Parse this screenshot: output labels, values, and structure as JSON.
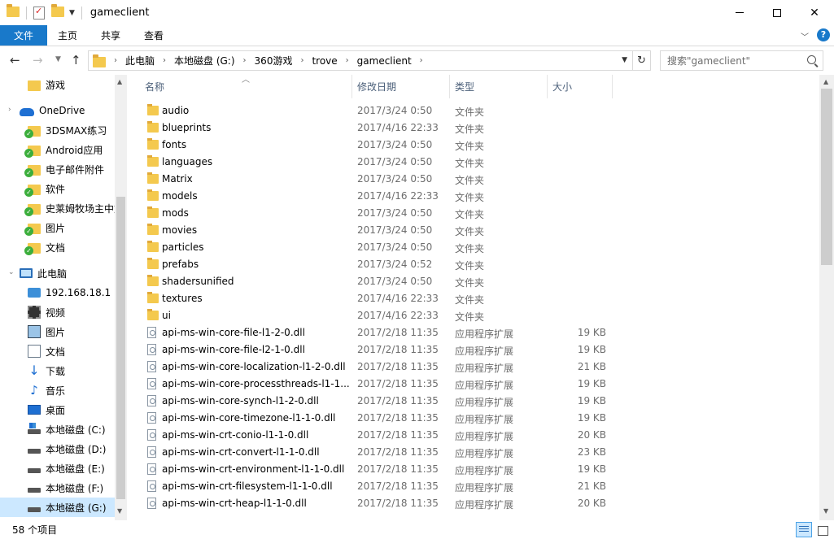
{
  "window": {
    "title": "gameclient"
  },
  "ribbon": {
    "tabs": [
      "文件",
      "主页",
      "共享",
      "查看"
    ]
  },
  "address": {
    "crumbs": [
      "此电脑",
      "本地磁盘 (G:)",
      "360游戏",
      "trove",
      "gameclient"
    ]
  },
  "search": {
    "placeholder": "搜索\"gameclient\""
  },
  "nav": {
    "items": [
      {
        "label": "游戏",
        "icon": "folder-icon"
      },
      {
        "label": "OneDrive",
        "icon": "cloud-icon"
      },
      {
        "label": "3DSMAX练习",
        "icon": "folder-synced-icon"
      },
      {
        "label": "Android应用",
        "icon": "folder-synced-icon"
      },
      {
        "label": "电子邮件附件",
        "icon": "folder-synced-icon"
      },
      {
        "label": "软件",
        "icon": "folder-synced-icon"
      },
      {
        "label": "史莱姆牧场主中文",
        "icon": "folder-synced-icon"
      },
      {
        "label": "图片",
        "icon": "folder-synced-icon"
      },
      {
        "label": "文档",
        "icon": "folder-synced-icon"
      },
      {
        "label": "此电脑",
        "icon": "pc-icon"
      },
      {
        "label": "192.168.18.1",
        "icon": "network-drive-icon"
      },
      {
        "label": "视频",
        "icon": "video-icon"
      },
      {
        "label": "图片",
        "icon": "pictures-icon"
      },
      {
        "label": "文档",
        "icon": "documents-icon"
      },
      {
        "label": "下载",
        "icon": "download-icon"
      },
      {
        "label": "音乐",
        "icon": "music-icon"
      },
      {
        "label": "桌面",
        "icon": "desktop-icon"
      },
      {
        "label": "本地磁盘 (C:)",
        "icon": "system-drive-icon"
      },
      {
        "label": "本地磁盘 (D:)",
        "icon": "drive-icon"
      },
      {
        "label": "本地磁盘 (E:)",
        "icon": "drive-icon"
      },
      {
        "label": "本地磁盘 (F:)",
        "icon": "drive-icon"
      },
      {
        "label": "本地磁盘 (G:)",
        "icon": "drive-icon",
        "selected": true
      }
    ]
  },
  "columns": {
    "name": "名称",
    "date": "修改日期",
    "type": "类型",
    "size": "大小"
  },
  "files": [
    {
      "name": "audio",
      "date": "2017/3/24 0:50",
      "type": "文件夹",
      "size": "",
      "kind": "folder"
    },
    {
      "name": "blueprints",
      "date": "2017/4/16 22:33",
      "type": "文件夹",
      "size": "",
      "kind": "folder"
    },
    {
      "name": "fonts",
      "date": "2017/3/24 0:50",
      "type": "文件夹",
      "size": "",
      "kind": "folder"
    },
    {
      "name": "languages",
      "date": "2017/3/24 0:50",
      "type": "文件夹",
      "size": "",
      "kind": "folder"
    },
    {
      "name": "Matrix",
      "date": "2017/3/24 0:50",
      "type": "文件夹",
      "size": "",
      "kind": "folder"
    },
    {
      "name": "models",
      "date": "2017/4/16 22:33",
      "type": "文件夹",
      "size": "",
      "kind": "folder"
    },
    {
      "name": "mods",
      "date": "2017/3/24 0:50",
      "type": "文件夹",
      "size": "",
      "kind": "folder"
    },
    {
      "name": "movies",
      "date": "2017/3/24 0:50",
      "type": "文件夹",
      "size": "",
      "kind": "folder"
    },
    {
      "name": "particles",
      "date": "2017/3/24 0:50",
      "type": "文件夹",
      "size": "",
      "kind": "folder"
    },
    {
      "name": "prefabs",
      "date": "2017/3/24 0:52",
      "type": "文件夹",
      "size": "",
      "kind": "folder"
    },
    {
      "name": "shadersunified",
      "date": "2017/3/24 0:50",
      "type": "文件夹",
      "size": "",
      "kind": "folder"
    },
    {
      "name": "textures",
      "date": "2017/4/16 22:33",
      "type": "文件夹",
      "size": "",
      "kind": "folder"
    },
    {
      "name": "ui",
      "date": "2017/4/16 22:33",
      "type": "文件夹",
      "size": "",
      "kind": "folder"
    },
    {
      "name": "api-ms-win-core-file-l1-2-0.dll",
      "date": "2017/2/18 11:35",
      "type": "应用程序扩展",
      "size": "19 KB",
      "kind": "dll"
    },
    {
      "name": "api-ms-win-core-file-l2-1-0.dll",
      "date": "2017/2/18 11:35",
      "type": "应用程序扩展",
      "size": "19 KB",
      "kind": "dll"
    },
    {
      "name": "api-ms-win-core-localization-l1-2-0.dll",
      "date": "2017/2/18 11:35",
      "type": "应用程序扩展",
      "size": "21 KB",
      "kind": "dll"
    },
    {
      "name": "api-ms-win-core-processthreads-l1-1...",
      "date": "2017/2/18 11:35",
      "type": "应用程序扩展",
      "size": "19 KB",
      "kind": "dll"
    },
    {
      "name": "api-ms-win-core-synch-l1-2-0.dll",
      "date": "2017/2/18 11:35",
      "type": "应用程序扩展",
      "size": "19 KB",
      "kind": "dll"
    },
    {
      "name": "api-ms-win-core-timezone-l1-1-0.dll",
      "date": "2017/2/18 11:35",
      "type": "应用程序扩展",
      "size": "19 KB",
      "kind": "dll"
    },
    {
      "name": "api-ms-win-crt-conio-l1-1-0.dll",
      "date": "2017/2/18 11:35",
      "type": "应用程序扩展",
      "size": "20 KB",
      "kind": "dll"
    },
    {
      "name": "api-ms-win-crt-convert-l1-1-0.dll",
      "date": "2017/2/18 11:35",
      "type": "应用程序扩展",
      "size": "23 KB",
      "kind": "dll"
    },
    {
      "name": "api-ms-win-crt-environment-l1-1-0.dll",
      "date": "2017/2/18 11:35",
      "type": "应用程序扩展",
      "size": "19 KB",
      "kind": "dll"
    },
    {
      "name": "api-ms-win-crt-filesystem-l1-1-0.dll",
      "date": "2017/2/18 11:35",
      "type": "应用程序扩展",
      "size": "21 KB",
      "kind": "dll"
    },
    {
      "name": "api-ms-win-crt-heap-l1-1-0.dll",
      "date": "2017/2/18 11:35",
      "type": "应用程序扩展",
      "size": "20 KB",
      "kind": "dll"
    }
  ],
  "status": {
    "count": "58 个项目"
  },
  "colors": {
    "accent": "#1979ca",
    "selection": "#cce8ff",
    "header_text": "#4c607a"
  }
}
